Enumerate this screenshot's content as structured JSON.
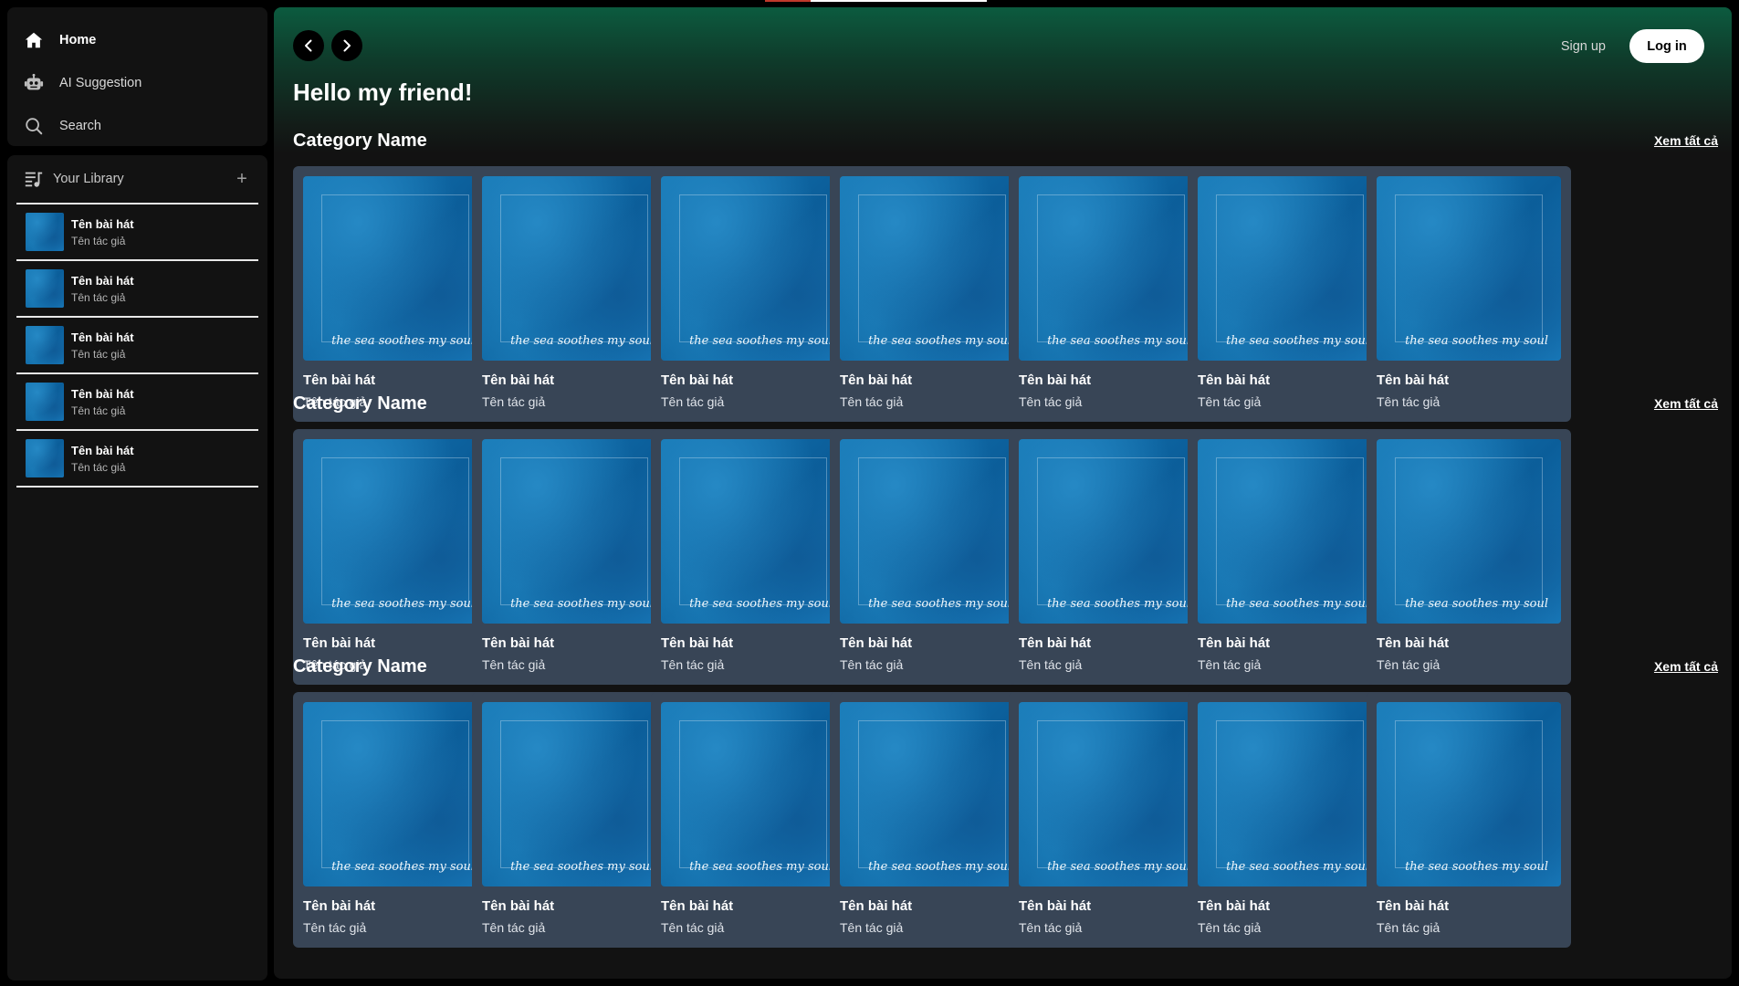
{
  "nav": {
    "items": [
      {
        "label": "Home",
        "icon": "home-icon"
      },
      {
        "label": "AI Suggestion",
        "icon": "robot-icon"
      },
      {
        "label": "Search",
        "icon": "search-icon"
      }
    ]
  },
  "library": {
    "title": "Your Library",
    "add": "+",
    "items": [
      {
        "title": "Tên bài hát",
        "artist": "Tên tác giả"
      },
      {
        "title": "Tên bài hát",
        "artist": "Tên tác giả"
      },
      {
        "title": "Tên bài hát",
        "artist": "Tên tác giả"
      },
      {
        "title": "Tên bài hát",
        "artist": "Tên tác giả"
      },
      {
        "title": "Tên bài hát",
        "artist": "Tên tác giả"
      }
    ]
  },
  "header": {
    "signup": "Sign up",
    "login": "Log in",
    "greeting": "Hello my friend!"
  },
  "art_caption": "the sea soothes my soul",
  "sections": [
    {
      "title": "Category Name",
      "see_all": "Xem tất cả",
      "cards": [
        {
          "title": "Tên bài hát",
          "artist": "Tên tác giả"
        },
        {
          "title": "Tên bài hát",
          "artist": "Tên tác giả"
        },
        {
          "title": "Tên bài hát",
          "artist": "Tên tác giả"
        },
        {
          "title": "Tên bài hát",
          "artist": "Tên tác giả"
        },
        {
          "title": "Tên bài hát",
          "artist": "Tên tác giả"
        },
        {
          "title": "Tên bài hát",
          "artist": "Tên tác giả"
        },
        {
          "title": "Tên bài hát",
          "artist": "Tên tác giả"
        }
      ]
    },
    {
      "title": "Category Name",
      "see_all": "Xem tất cả",
      "cards": [
        {
          "title": "Tên bài hát",
          "artist": "Tên tác giả"
        },
        {
          "title": "Tên bài hát",
          "artist": "Tên tác giả"
        },
        {
          "title": "Tên bài hát",
          "artist": "Tên tác giả"
        },
        {
          "title": "Tên bài hát",
          "artist": "Tên tác giả"
        },
        {
          "title": "Tên bài hát",
          "artist": "Tên tác giả"
        },
        {
          "title": "Tên bài hát",
          "artist": "Tên tác giả"
        },
        {
          "title": "Tên bài hát",
          "artist": "Tên tác giả"
        }
      ]
    },
    {
      "title": "Category Name",
      "see_all": "Xem tất cả",
      "cards": [
        {
          "title": "Tên bài hát",
          "artist": "Tên tác giả"
        },
        {
          "title": "Tên bài hát",
          "artist": "Tên tác giả"
        },
        {
          "title": "Tên bài hát",
          "artist": "Tên tác giả"
        },
        {
          "title": "Tên bài hát",
          "artist": "Tên tác giả"
        },
        {
          "title": "Tên bài hát",
          "artist": "Tên tác giả"
        },
        {
          "title": "Tên bài hát",
          "artist": "Tên tác giả"
        },
        {
          "title": "Tên bài hát",
          "artist": "Tên tác giả"
        }
      ]
    }
  ],
  "colors": {
    "background": "#000000",
    "panel": "#121212",
    "card": "#384556",
    "header_gradient_top": "#0c5b3f",
    "accent_white": "#ffffff"
  }
}
